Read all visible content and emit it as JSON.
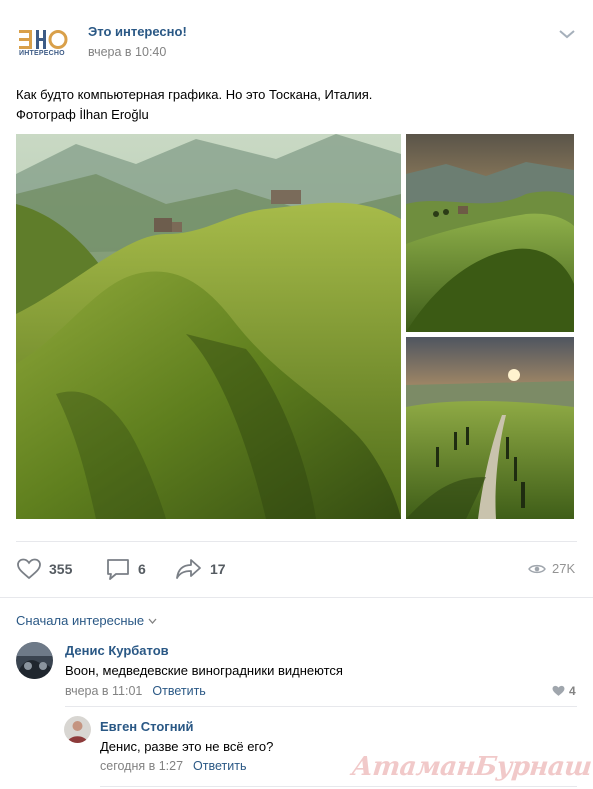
{
  "post": {
    "author": "Это интересно!",
    "time": "вчера в 10:40",
    "logo_text": "ИНТЕРЕСНО",
    "text_line1": "Как будто компьютерная графика. Но это Тоскана, Италия.",
    "text_line2": "Фотограф İlhan Eroğlu"
  },
  "actions": {
    "likes": "355",
    "comments": "6",
    "shares": "17",
    "views": "27K"
  },
  "comments_sort": "Сначала интересные",
  "comments": [
    {
      "name": "Денис Курбатов",
      "text": "Воон, медведевские виноградники виднеются",
      "time": "вчера в 11:01",
      "reply_label": "Ответить",
      "likes": "4"
    },
    {
      "name": "Евген Стогний",
      "text": "Денис, разве это не всё его?",
      "time": "сегодня в 1:27",
      "reply_label": "Ответить"
    }
  ],
  "watermark": "АтаманБурнаш для ЯП",
  "colors": {
    "link": "#2a5885",
    "meta": "#828282",
    "divider": "#e7e8ec",
    "icon": "#7a7f86"
  }
}
